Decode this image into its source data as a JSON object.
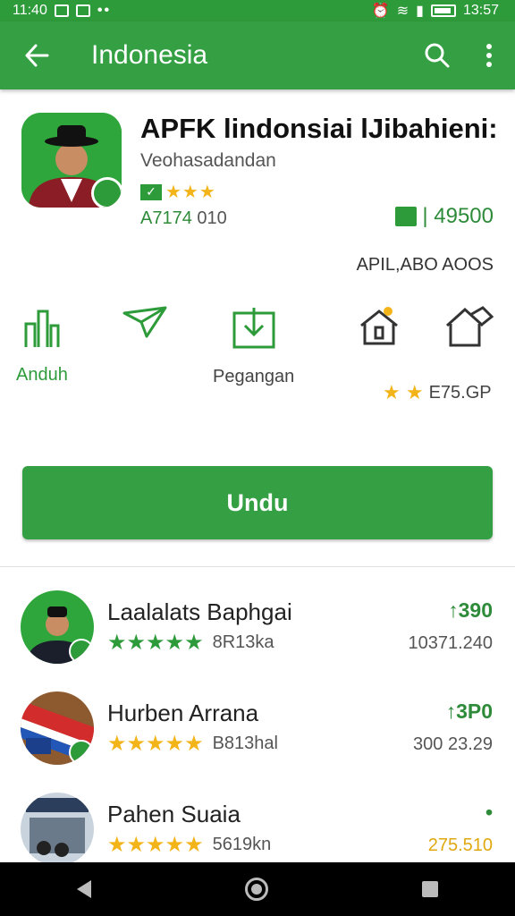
{
  "status_bar": {
    "time": "11:40",
    "clock_right": "13:57"
  },
  "app_bar": {
    "title": "Indonesia",
    "back_icon": "arrow-left-icon",
    "search_icon": "search-icon",
    "menu_icon": "more-vert-icon"
  },
  "app": {
    "title": "APFK lindonsiai lJibahieni:",
    "developer": "Veohasadandan",
    "rating_stars": 3,
    "meta_left": "A7174",
    "meta_right": "010",
    "downloads": "| 49500",
    "ad_label": "APIL,ABO AOOS"
  },
  "actions": [
    {
      "label": "Anduh",
      "icon": "bar-chart-icon"
    },
    {
      "label": "",
      "icon": "send-icon"
    },
    {
      "label": "Pegangan",
      "icon": "download-icon"
    },
    {
      "label": "",
      "icon": "home-pin-icon"
    },
    {
      "label": "E75.GP",
      "icon": "home-hand-icon"
    }
  ],
  "action_stars": "★ ★",
  "install_label": "Undu",
  "list": [
    {
      "title": "Laalalats Baphgai",
      "count": "8R13ka",
      "price": "↑390",
      "size": "10371.240",
      "stars": "★★★★★",
      "star_color": "green"
    },
    {
      "title": "Hurben Arrana",
      "count": "B813hal",
      "price": "↑3P0",
      "size": "300 23.29",
      "stars": "★★★★★",
      "star_color": "mixed"
    },
    {
      "title": "Pahen Suaia",
      "count": "5619kn",
      "price": "•",
      "size": "275.510",
      "stars": "★★★★★",
      "star_color": "yellow"
    }
  ],
  "colors": {
    "primary": "#34a043",
    "star": "#f3b41a",
    "status_bar": "#2e9b3a"
  }
}
